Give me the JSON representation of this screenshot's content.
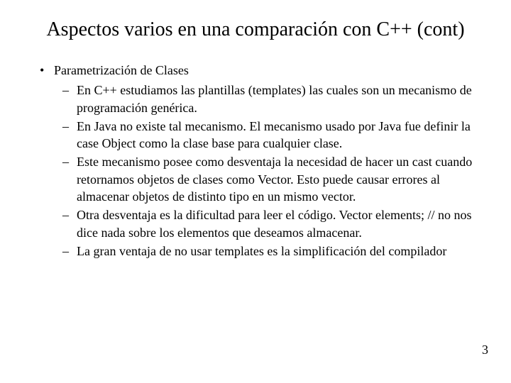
{
  "title": "Aspectos varios en una comparación con C++ (cont)",
  "bullet1": {
    "heading": "Parametrización de Clases",
    "items": [
      "En C++ estudiamos las plantillas (templates) las cuales son un mecanismo de programación genérica.",
      "En Java no existe tal mecanismo. El mecanismo usado por Java fue definir la case Object como la clase base para cualquier clase.",
      "Este mecanismo posee como desventaja la necesidad de hacer un cast cuando retornamos objetos de clases como Vector. Esto puede causar errores al almacenar objetos de distinto tipo en un mismo vector.",
      "Otra desventaja es la dificultad para leer el código. Vector elements; // no nos dice nada sobre los elementos que deseamos almacenar.",
      "La gran ventaja de no usar templates es la simplificación del compilador"
    ]
  },
  "pageNumber": "3"
}
